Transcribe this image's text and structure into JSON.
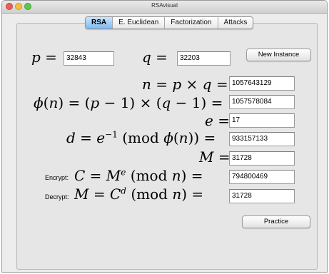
{
  "window": {
    "title": "RSAvisual",
    "tabs": [
      {
        "label": "RSA",
        "active": true
      },
      {
        "label": "E. Euclidean",
        "active": false
      },
      {
        "label": "Factorization",
        "active": false
      },
      {
        "label": "Attacks",
        "active": false
      }
    ]
  },
  "labels": {
    "p": "p",
    "q": "q",
    "n": "n",
    "phi": "ϕ",
    "e": "e",
    "d": "d",
    "M": "M",
    "C": "C",
    "mod": "mod",
    "encrypt": "Encrypt:",
    "decrypt": "Decrypt:"
  },
  "fields": {
    "p": "32843",
    "q": "32203",
    "n": "1057643129",
    "phi": "1057578084",
    "e": "17",
    "d": "933157133",
    "M": "31728",
    "C": "794800469",
    "M_decrypted": "31728"
  },
  "buttons": {
    "new_instance": "New Instance",
    "practice": "Practice"
  },
  "colors": {
    "window_bg": "#ececec",
    "active_tab": "#7fb9f2"
  }
}
